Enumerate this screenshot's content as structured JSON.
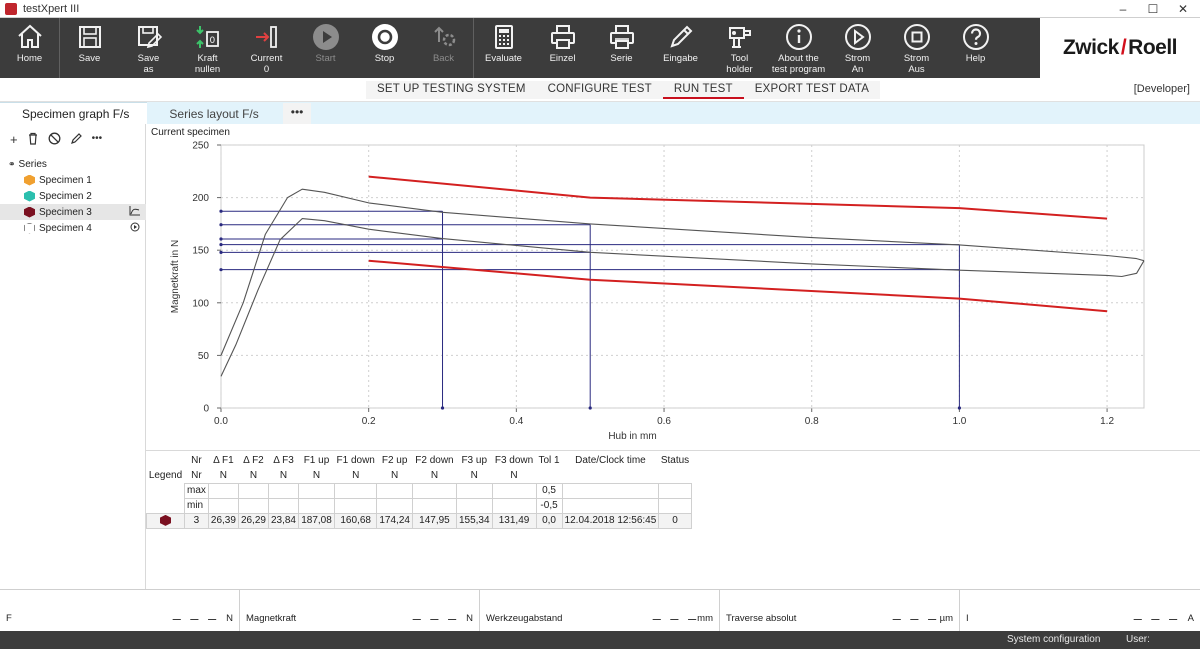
{
  "window": {
    "title": "testXpert III"
  },
  "toolbar": {
    "buttons": [
      {
        "label": "Home",
        "icon": "home-icon",
        "enabled": true
      },
      {
        "label": "Save",
        "icon": "floppy-icon",
        "enabled": true
      },
      {
        "label": "Save\nas",
        "icon": "floppy-edit-icon",
        "enabled": true
      },
      {
        "label": "Kraft\nnullen",
        "icon": "force-zero-icon",
        "enabled": true
      },
      {
        "label": "Current\n0",
        "icon": "current-position-icon",
        "enabled": true
      },
      {
        "label": "Start",
        "icon": "play-icon",
        "enabled": false
      },
      {
        "label": "Stop",
        "icon": "stop-icon",
        "enabled": true
      },
      {
        "label": "Back",
        "icon": "back-icon",
        "enabled": false
      },
      {
        "label": "Evaluate",
        "icon": "calculator-icon",
        "enabled": true
      },
      {
        "label": "Einzel",
        "icon": "printer-icon",
        "enabled": true
      },
      {
        "label": "Serie",
        "icon": "printer-series-icon",
        "enabled": true
      },
      {
        "label": "Eingabe",
        "icon": "pencil-icon",
        "enabled": true
      },
      {
        "label": "Tool\nholder",
        "icon": "tool-holder-icon",
        "enabled": true
      },
      {
        "label": "About the\ntest program",
        "icon": "info-icon",
        "enabled": true
      },
      {
        "label": "Strom\nAn",
        "icon": "power-on-icon",
        "enabled": true
      },
      {
        "label": "Strom\nAus",
        "icon": "power-off-icon",
        "enabled": true
      },
      {
        "label": "Help",
        "icon": "help-icon",
        "enabled": true
      }
    ],
    "brand_left": "Zwick",
    "brand_right": "Roell"
  },
  "nav": {
    "tabs": [
      "SET UP TESTING SYSTEM",
      "CONFIGURE TEST",
      "RUN TEST",
      "EXPORT TEST DATA"
    ],
    "active": "RUN TEST",
    "role": "[Developer]"
  },
  "subtabs": {
    "tabs": [
      "Specimen graph F/s",
      "Series layout F/s"
    ],
    "more": "•••"
  },
  "sidebar": {
    "root": "Series",
    "items": [
      {
        "label": "Specimen 1",
        "color": "#f0a030"
      },
      {
        "label": "Specimen 2",
        "color": "#2bbfae"
      },
      {
        "label": "Specimen 3",
        "color": "#7a1020"
      },
      {
        "label": "Specimen 4",
        "color": "#ffffff"
      }
    ]
  },
  "chart": {
    "title": "Current specimen"
  },
  "chart_data": {
    "type": "line",
    "xlabel": "Hub in mm",
    "ylabel": "Magnetkraft in N",
    "xlim": [
      0,
      1.25
    ],
    "ylim": [
      0,
      250
    ],
    "xticks": [
      "0.0",
      "0.2",
      "0.4",
      "0.6",
      "0.8",
      "1.0",
      "1.2"
    ],
    "yticks": [
      "0",
      "50",
      "100",
      "150",
      "200",
      "250"
    ],
    "grid": true,
    "series": [
      {
        "color": "#d32020",
        "x": [
          0.2,
          0.5,
          1.0,
          1.2
        ],
        "y": [
          220,
          200,
          190,
          180
        ]
      },
      {
        "color": "#d32020",
        "x": [
          0.2,
          0.5,
          1.0,
          1.2
        ],
        "y": [
          140,
          122,
          104,
          92
        ]
      },
      {
        "color": "#555555",
        "x": [
          0.0,
          0.03,
          0.06,
          0.09,
          0.11,
          0.14,
          0.2,
          0.3,
          0.5,
          0.8,
          1.0,
          1.2,
          1.24,
          1.25
        ],
        "y": [
          50,
          100,
          165,
          200,
          208,
          205,
          195,
          186,
          175,
          162,
          155,
          145,
          142,
          140
        ]
      },
      {
        "color": "#555555",
        "x": [
          1.25,
          1.24,
          1.22,
          1.2,
          1.0,
          0.8,
          0.5,
          0.3,
          0.2,
          0.14,
          0.11,
          0.08,
          0.05,
          0.02,
          0.0
        ],
        "y": [
          140,
          128,
          125,
          126,
          131,
          137,
          148,
          161,
          170,
          178,
          180,
          160,
          112,
          60,
          30
        ]
      }
    ],
    "markers": [
      {
        "x": 0.3,
        "y_up": 187.08,
        "y_down": 160.68
      },
      {
        "x": 0.5,
        "y_up": 174.24,
        "y_down": 147.95
      },
      {
        "x": 1.0,
        "y_up": 155.34,
        "y_down": 131.49
      }
    ]
  },
  "results": {
    "headers": [
      "Legend",
      "Nr",
      "Δ F1",
      "Δ F2",
      "Δ F3",
      "F1 up",
      "F1 down",
      "F2 up",
      "F2 down",
      "F3 up",
      "F3 down",
      "Tol 1",
      "Date/Clock time",
      "Status"
    ],
    "units": [
      "",
      "",
      "N",
      "N",
      "N",
      "N",
      "N",
      "N",
      "N",
      "N",
      "N",
      "",
      "",
      ""
    ],
    "max_row": {
      "label": "max",
      "tol": "0,5"
    },
    "min_row": {
      "label": "min",
      "tol": "-0,5"
    },
    "row": [
      "3",
      "26,39",
      "26,29",
      "23,84",
      "187,08",
      "160,68",
      "174,24",
      "147,95",
      "155,34",
      "131,49",
      "0,0",
      "12.04.2018 12:56:45",
      "0"
    ]
  },
  "measure": [
    {
      "label": "F",
      "value": "_ _ _",
      "unit": "N"
    },
    {
      "label": "Magnetkraft",
      "value": "_ _ _",
      "unit": "N"
    },
    {
      "label": "Werkzeugabstand",
      "value": "_ _ _",
      "unit": "mm"
    },
    {
      "label": "Traverse absolut",
      "value": "_ _ _",
      "unit": "µm"
    },
    {
      "label": "I",
      "value": "_ _ _",
      "unit": "A"
    }
  ],
  "status": {
    "system": "System configuration",
    "user": "User:"
  }
}
